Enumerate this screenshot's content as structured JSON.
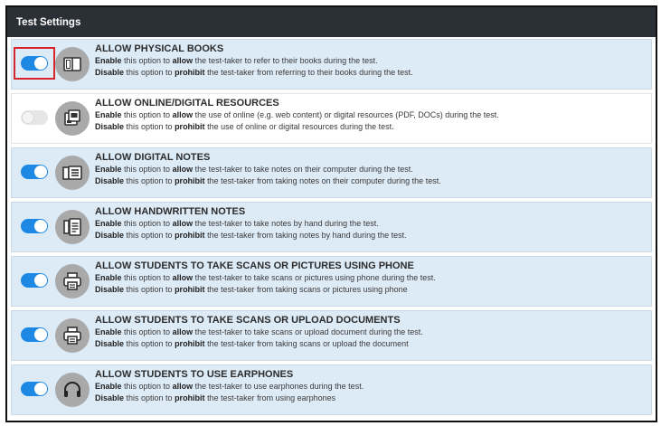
{
  "panel": {
    "title": "Test Settings"
  },
  "settings": [
    {
      "title": "ALLOW PHYSICAL BOOKS",
      "enabled": true,
      "icon": "book-icon",
      "enable_prefix": "Enable",
      "enable_mid": " this option to ",
      "enable_verb": "allow",
      "enable_rest": " the test-taker to refer to their books during the test.",
      "disable_prefix": "Disable",
      "disable_mid": " this option to ",
      "disable_verb": "prohibit",
      "disable_rest": " the test-taker from referring to their books during the test."
    },
    {
      "title": "ALLOW ONLINE/DIGITAL RESOURCES",
      "enabled": false,
      "icon": "digital-resources-icon",
      "enable_prefix": "Enable",
      "enable_mid": " this option to ",
      "enable_verb": "allow",
      "enable_rest": " the use of online (e.g. web content) or digital resources (PDF, DOCs) during the test.",
      "disable_prefix": "Disable",
      "disable_mid": " this option to ",
      "disable_verb": "prohibit",
      "disable_rest": " the use of online or digital resources during the test."
    },
    {
      "title": "ALLOW DIGITAL NOTES",
      "enabled": true,
      "icon": "digital-notes-icon",
      "enable_prefix": "Enable",
      "enable_mid": " this option to ",
      "enable_verb": "allow",
      "enable_rest": " the test-taker to take notes on their computer during the test.",
      "disable_prefix": "Disable",
      "disable_mid": " this option to ",
      "disable_verb": "prohibit",
      "disable_rest": " the test-taker from taking notes on their computer during the test."
    },
    {
      "title": "ALLOW HANDWRITTEN NOTES",
      "enabled": true,
      "icon": "handwritten-notes-icon",
      "enable_prefix": "Enable",
      "enable_mid": " this option to ",
      "enable_verb": "allow",
      "enable_rest": " the test-taker to take notes by hand during the test.",
      "disable_prefix": "Disable",
      "disable_mid": " this option to ",
      "disable_verb": "prohibit",
      "disable_rest": " the test-taker from taking notes by hand during the test."
    },
    {
      "title": "ALLOW STUDENTS TO TAKE SCANS OR PICTURES USING PHONE",
      "enabled": true,
      "icon": "printer-icon",
      "enable_prefix": "Enable",
      "enable_mid": " this option to ",
      "enable_verb": "allow",
      "enable_rest": " the test-taker to take scans or pictures using phone during the test.",
      "disable_prefix": "Disable",
      "disable_mid": " this option to ",
      "disable_verb": "prohibit",
      "disable_rest": " the test-taker from taking scans or pictures using phone"
    },
    {
      "title": "ALLOW STUDENTS TO TAKE SCANS OR UPLOAD DOCUMENTS",
      "enabled": true,
      "icon": "printer-icon",
      "enable_prefix": "Enable",
      "enable_mid": " this option to ",
      "enable_verb": "allow",
      "enable_rest": " the test-taker to take scans or upload document during the test.",
      "disable_prefix": "Disable",
      "disable_mid": " this option to ",
      "disable_verb": "prohibit",
      "disable_rest": " the test-taker from taking scans or upload the document"
    },
    {
      "title": "ALLOW STUDENTS TO USE EARPHONES",
      "enabled": true,
      "icon": "headphones-icon",
      "enable_prefix": "Enable",
      "enable_mid": " this option to ",
      "enable_verb": "allow",
      "enable_rest": " the test-taker to use earphones during the test.",
      "disable_prefix": "Disable",
      "disable_mid": " this option to ",
      "disable_verb": "prohibit",
      "disable_rest": " the test-taker from using earphones"
    }
  ],
  "colors": {
    "toggle_on": "#1e88e5",
    "row_on": "#ddebf7",
    "header": "#2b2f36",
    "highlight": "#d6262b"
  }
}
